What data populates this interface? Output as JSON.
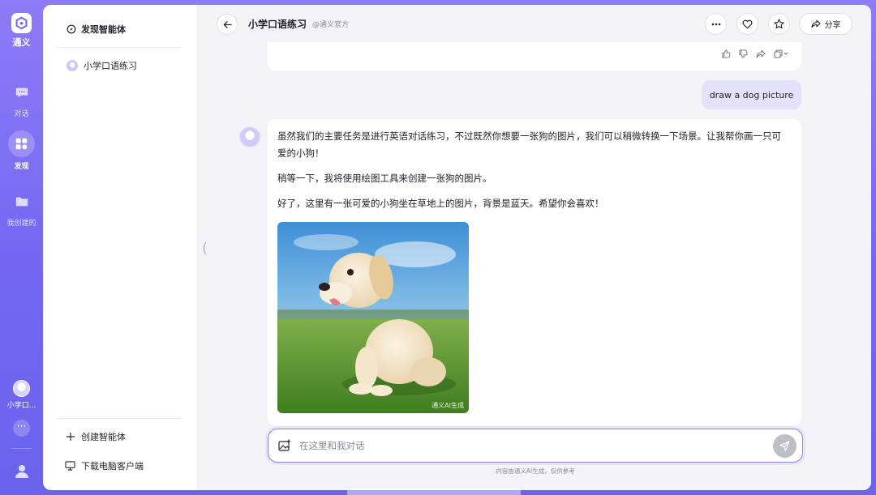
{
  "app": {
    "name": "通义"
  },
  "rail": {
    "items": [
      {
        "label": "对话",
        "icon": "chat-icon"
      },
      {
        "label": "发现",
        "icon": "apps-icon",
        "active": true
      },
      {
        "label": "我创建的",
        "icon": "folder-icon"
      }
    ],
    "agent_label": "小学口...",
    "more_label": "···"
  },
  "sidebar": {
    "discover_label": "发现智能体",
    "agents": [
      {
        "name": "小学口语练习"
      }
    ],
    "create_label": "创建智能体",
    "download_label": "下载电脑客户端"
  },
  "header": {
    "title": "小学口语练习",
    "subtitle": "@通义官方",
    "share_label": "分享"
  },
  "conversation": {
    "user_message": "draw a dog picture",
    "bot_paragraphs": [
      "虽然我们的主要任务是进行英语对话练习，不过既然你想要一张狗的图片，我们可以稍微转换一下场景。让我帮你画一只可爱的小狗！",
      "稍等一下，我将使用绘图工具来创建一张狗的图片。",
      "好了，这里有一张可爱的小狗坐在草地上的图片，背景是蓝天。希望你会喜欢！"
    ],
    "image_watermark": "通义AI生成"
  },
  "input": {
    "placeholder": "在这里和我对话",
    "value": ""
  },
  "disclaimer": "内容由通义AI生成，仅供参考",
  "colors": {
    "accent": "#7466f2",
    "user_bubble": "#e4e2fb",
    "send_disabled": "#bebec6"
  }
}
